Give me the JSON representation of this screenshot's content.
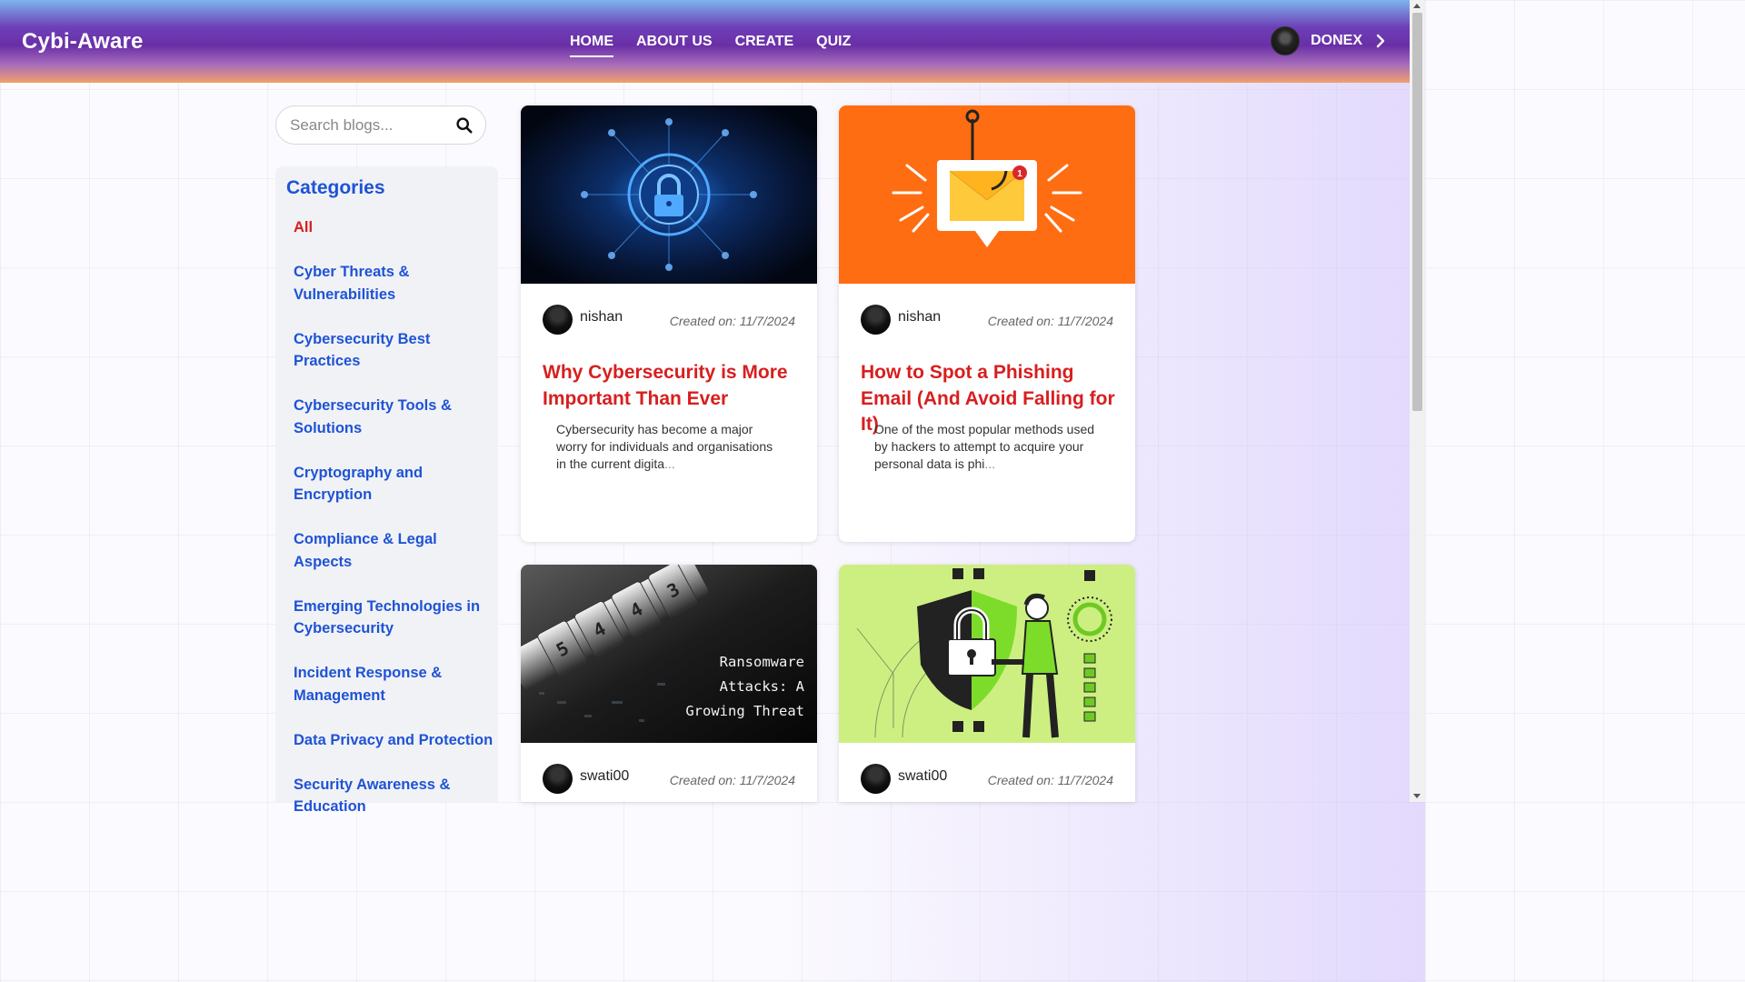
{
  "navbar": {
    "brand": "Cybi-Aware",
    "links": [
      "HOME",
      "ABOUT US",
      "CREATE",
      "QUIZ"
    ],
    "active_link": "HOME",
    "user_name": "DONEX"
  },
  "search": {
    "placeholder": "Search blogs..."
  },
  "sidebar": {
    "title": "Categories",
    "items": [
      "All",
      "Cyber Threats & Vulnerabilities",
      "Cybersecurity Best Practices",
      "Cybersecurity Tools & Solutions",
      "Cryptography and Encryption",
      "Compliance & Legal Aspects",
      "Emerging Technologies in Cybersecurity",
      "Incident Response & Management",
      "Data Privacy and Protection",
      "Security Awareness & Education"
    ],
    "active_item": "All"
  },
  "posts": [
    {
      "image": "digital-lock-circuit",
      "author": "nishan",
      "created": "Created on: 11/7/2024",
      "title": "Why Cybersecurity is More Important Than Ever",
      "excerpt": "Cybersecurity has become a major worry for individuals and organisations in the current digita",
      "ellipsis": "..."
    },
    {
      "image": "phishing-email-hook",
      "author": "nishan",
      "created": "Created on: 11/7/2024",
      "title": "How to Spot a Phishing Email (And Avoid Falling for It)",
      "excerpt": "One of the most popular methods used by hackers to attempt to acquire your personal data is phi",
      "ellipsis": "...",
      "badge": "1"
    },
    {
      "image": "combination-lock-ransomware",
      "image_caption": [
        "Ransomware",
        "Attacks: A",
        "Growing Threat"
      ],
      "author": "swati00",
      "created": "Created on: 11/7/2024"
    },
    {
      "image": "shield-padlock-person",
      "author": "swati00",
      "created": "Created on: 11/7/2024"
    }
  ],
  "colors": {
    "brand_blue": "#1e53d6",
    "accent_red": "#d81e1e",
    "phishing_orange": "#ff6d12",
    "shield_green": "#c8ec7a"
  }
}
